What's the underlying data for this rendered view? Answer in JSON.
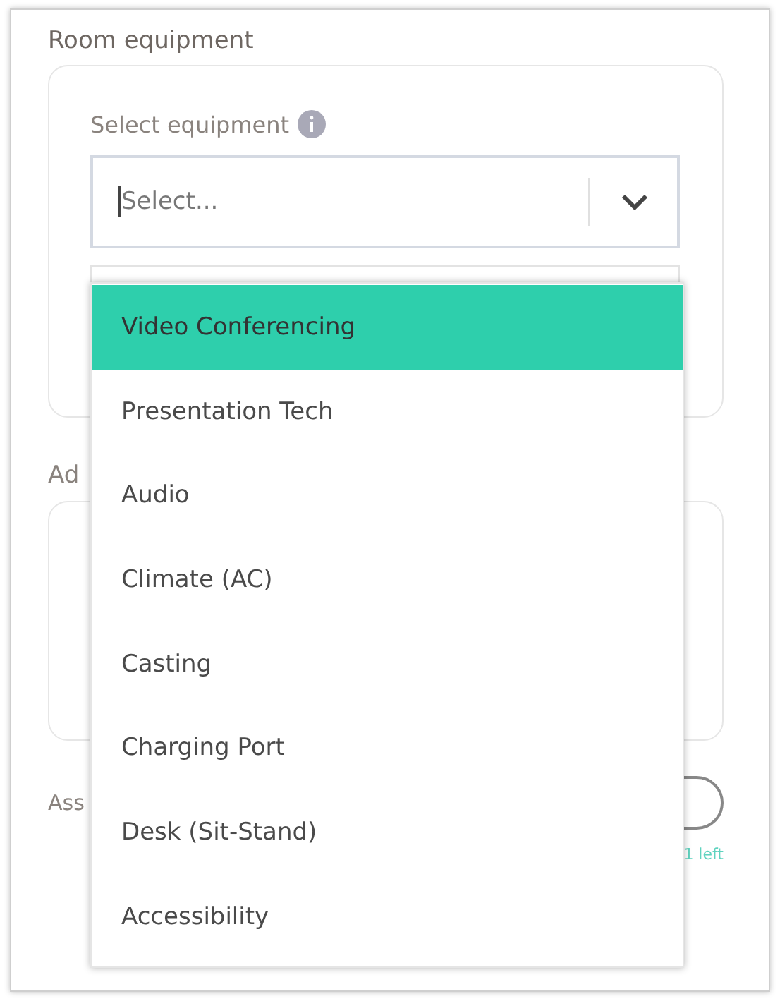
{
  "section_title": "Room equipment",
  "equipment_field": {
    "label": "Select equipment",
    "placeholder": "Select..."
  },
  "dropdown": {
    "options": [
      {
        "label": "Video Conferencing",
        "selected": true
      },
      {
        "label": "Presentation Tech",
        "selected": false
      },
      {
        "label": "Audio",
        "selected": false
      },
      {
        "label": "Climate (AC)",
        "selected": false
      },
      {
        "label": "Casting",
        "selected": false
      },
      {
        "label": "Charging Port",
        "selected": false
      },
      {
        "label": "Desk (Sit-Stand)",
        "selected": false
      },
      {
        "label": "Accessibility",
        "selected": false
      }
    ]
  },
  "next_section_title": "Ad",
  "next_field_label": "Ass",
  "counter": "1 left"
}
